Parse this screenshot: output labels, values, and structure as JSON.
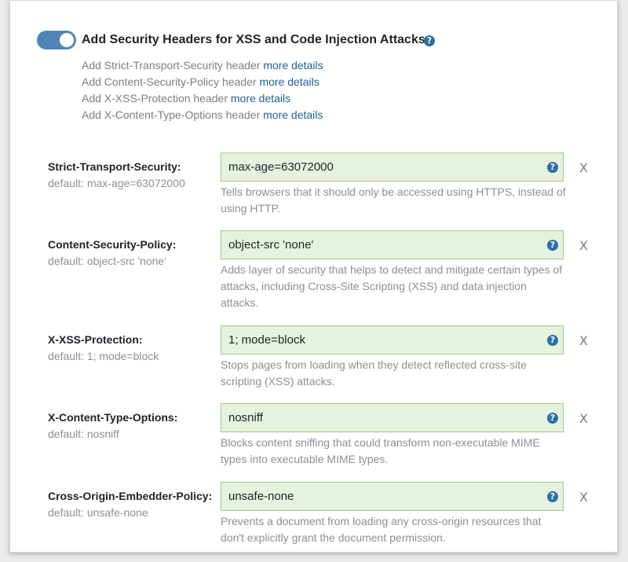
{
  "section": {
    "title": "Add Security Headers for XSS and Code Injection Attacks",
    "help_icon": "question-circle-icon",
    "toggle_on": true,
    "details": [
      {
        "text": "Add Strict-Transport-Security header",
        "link": "more details"
      },
      {
        "text": "Add Content-Security-Policy header",
        "link": "more details"
      },
      {
        "text": "Add X-XSS-Protection header",
        "link": "more details"
      },
      {
        "text": "Add X-Content-Type-Options header",
        "link": "more details"
      }
    ]
  },
  "headers": [
    {
      "name": "Strict-Transport-Security:",
      "default": "default: max-age=63072000",
      "value": "max-age=63072000",
      "description": "Tells browsers that it should only be accessed using HTTPS, instead of using HTTP.",
      "remove": "X"
    },
    {
      "name": "Content-Security-Policy:",
      "default": "default: object-src 'none'",
      "value": "object-src 'none'",
      "description": "Adds layer of security that helps to detect and mitigate certain types of attacks, including Cross-Site Scripting (XSS) and data injection attacks.",
      "remove": "X"
    },
    {
      "name": "X-XSS-Protection:",
      "default": "default: 1; mode=block",
      "value": "1; mode=block",
      "description": "Stops pages from loading when they detect reflected cross-site scripting (XSS) attacks.",
      "remove": "X"
    },
    {
      "name": "X-Content-Type-Options:",
      "default": "default: nosniff",
      "value": "nosniff",
      "description": "Blocks content sniffing that could transform non-executable MIME types into executable MIME types.",
      "remove": "X"
    },
    {
      "name": "Cross-Origin-Embedder-Policy:",
      "default": "default: unsafe-none",
      "value": "unsafe-none",
      "description": "Prevents a document from loading any cross-origin resources that don't explicitly grant the document permission.",
      "remove": "X"
    }
  ],
  "colors": {
    "toggle": "#4f86b4",
    "field_bg": "#e6f2dd",
    "field_border": "#a5c48f",
    "link": "#1f5f99"
  }
}
